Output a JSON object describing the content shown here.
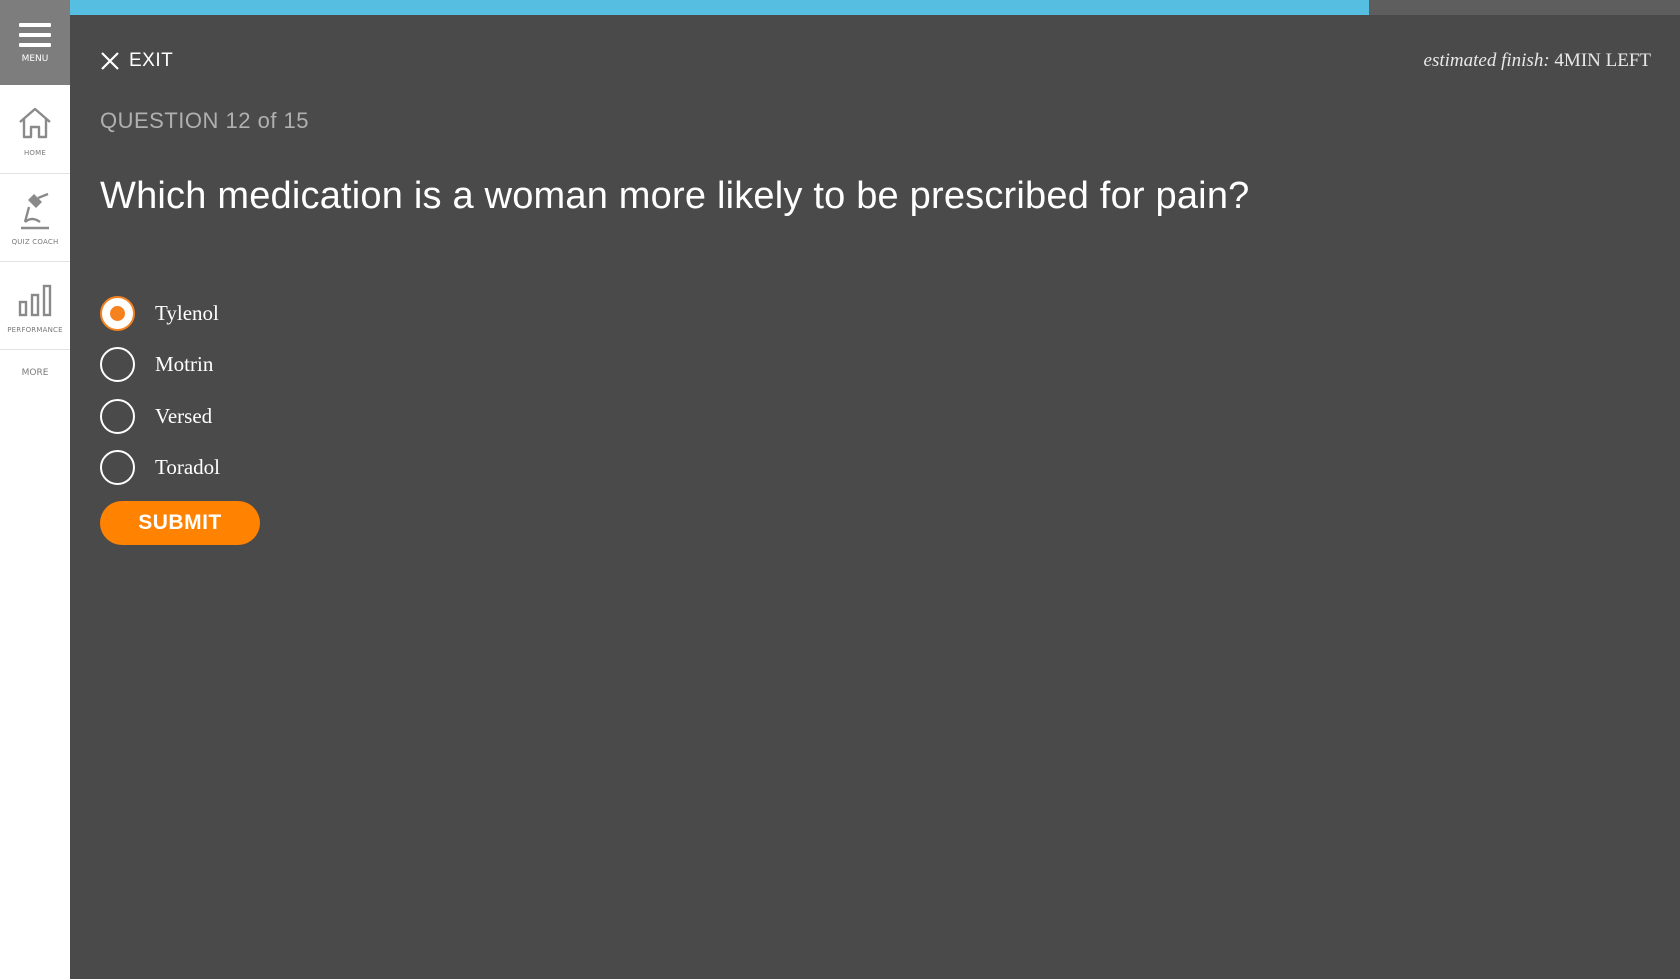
{
  "sidebar": {
    "menu_label": "MENU",
    "items": [
      {
        "label": "HOME",
        "icon": "home-icon"
      },
      {
        "label": "QUIZ COACH",
        "icon": "coach-icon"
      },
      {
        "label": "PERFORMANCE",
        "icon": "bar-chart-icon"
      }
    ],
    "more_label": "MORE"
  },
  "progress": {
    "fraction": 0.807
  },
  "header": {
    "exit_label": "EXIT",
    "finish_prefix": "estimated finish:",
    "finish_value": "4MIN LEFT"
  },
  "quiz": {
    "count_label": "QUESTION 12 of 15",
    "question": "Which medication is a woman more likely to be prescribed for pain?",
    "options": [
      {
        "label": "Tylenol",
        "selected": true
      },
      {
        "label": "Motrin",
        "selected": false
      },
      {
        "label": "Versed",
        "selected": false
      },
      {
        "label": "Toradol",
        "selected": false
      }
    ],
    "submit_label": "SUBMIT"
  },
  "colors": {
    "background": "#4a4a4a",
    "accent": "#f5821f",
    "progress": "#56bee0"
  }
}
